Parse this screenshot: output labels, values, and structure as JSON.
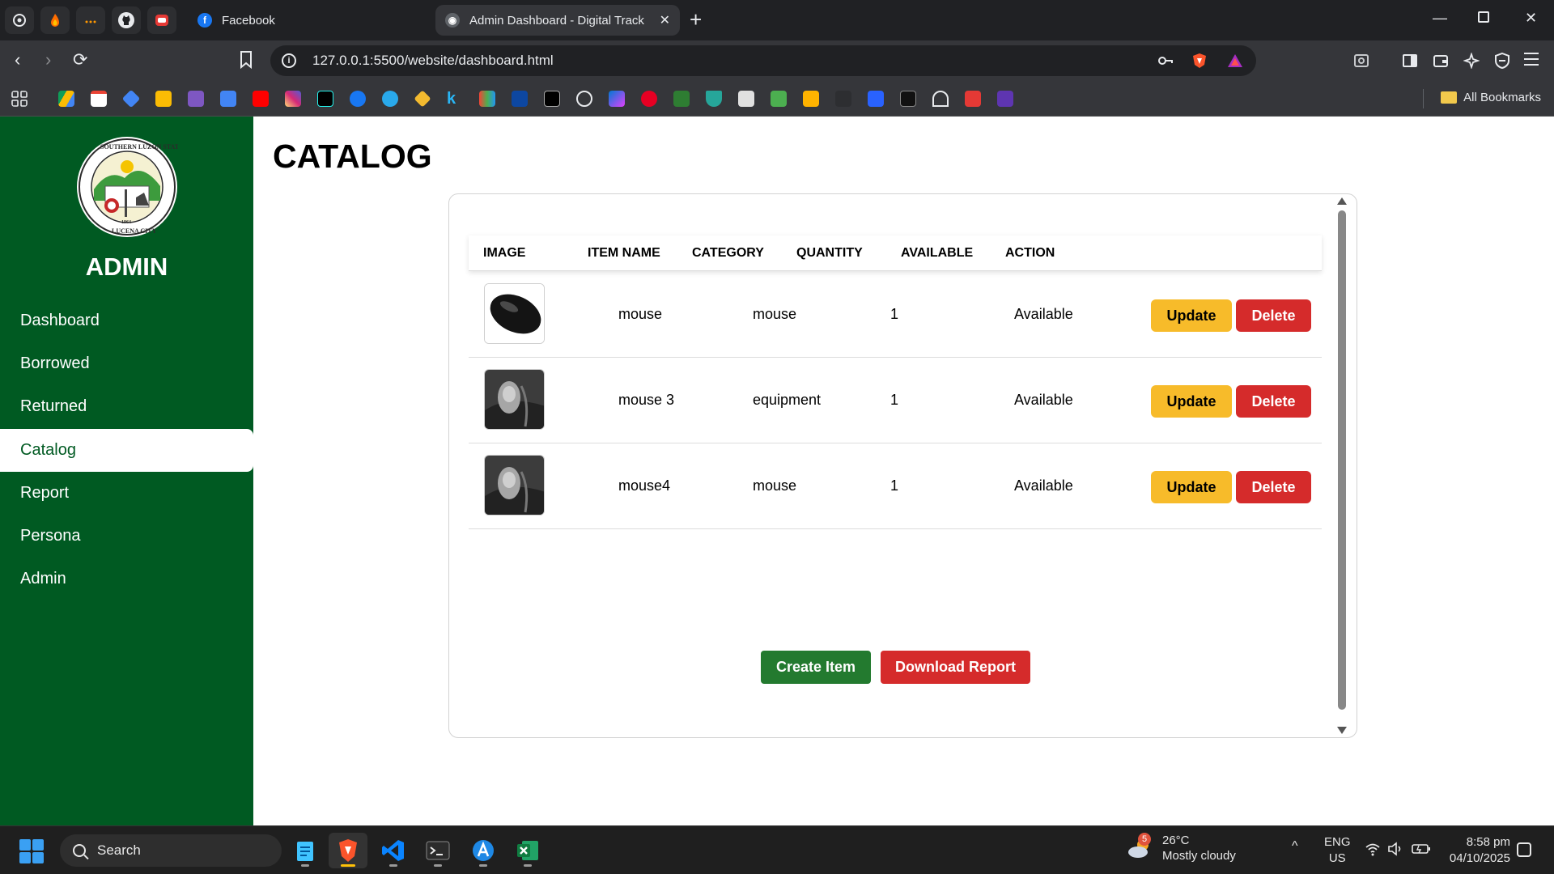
{
  "browser": {
    "pinned_tabs": [
      {
        "icon": "chatgpt-icon"
      },
      {
        "icon": "fire-icon"
      },
      {
        "icon": "dots-icon"
      },
      {
        "icon": "github-icon"
      },
      {
        "icon": "app-icon"
      }
    ],
    "tabs": [
      {
        "title": "Facebook",
        "icon": "facebook-icon",
        "active": false
      },
      {
        "title": "Admin Dashboard - Digital Track",
        "icon": "globe-icon",
        "active": true
      }
    ],
    "url": "127.0.0.1:5500/website/dashboard.html",
    "all_bookmarks_label": "All Bookmarks"
  },
  "sidebar": {
    "title": "ADMIN",
    "logo": {
      "text": "SOUTHERN LUZON STATE UNIVERSITY LUCENA CAMPUS · LUCENA CITY",
      "year": "1964"
    },
    "items": [
      {
        "label": "Dashboard",
        "active": false
      },
      {
        "label": "Borrowed",
        "active": false
      },
      {
        "label": "Returned",
        "active": false
      },
      {
        "label": "Catalog",
        "active": true
      },
      {
        "label": "Report",
        "active": false
      },
      {
        "label": "Persona",
        "active": false
      },
      {
        "label": "Admin",
        "active": false
      }
    ]
  },
  "main": {
    "title": "CATALOG",
    "table": {
      "headers": [
        "IMAGE",
        "ITEM NAME",
        "CATEGORY",
        "QUANTITY",
        "AVAILABLE",
        "ACTION"
      ],
      "rows": [
        {
          "name": "mouse",
          "category": "mouse",
          "quantity": "1",
          "available": "Available",
          "image": "black-mouse"
        },
        {
          "name": "mouse 3",
          "category": "equipment",
          "quantity": "1",
          "available": "Available",
          "image": "grey-mouse"
        },
        {
          "name": "mouse4",
          "category": "mouse",
          "quantity": "1",
          "available": "Available",
          "image": "grey-mouse"
        }
      ],
      "update_label": "Update",
      "delete_label": "Delete"
    },
    "create_label": "Create Item",
    "download_label": "Download Report"
  },
  "taskbar": {
    "search_label": "Search",
    "weather": {
      "badge": "5",
      "temp": "26°C",
      "desc": "Mostly cloudy"
    },
    "lang": {
      "line1": "ENG",
      "line2": "US"
    },
    "clock": {
      "time": "8:58 pm",
      "date": "04/10/2025"
    }
  },
  "colors": {
    "sidebar": "#005a22",
    "update": "#f7bb2a",
    "delete": "#d52b2b",
    "create": "#237a2f"
  }
}
